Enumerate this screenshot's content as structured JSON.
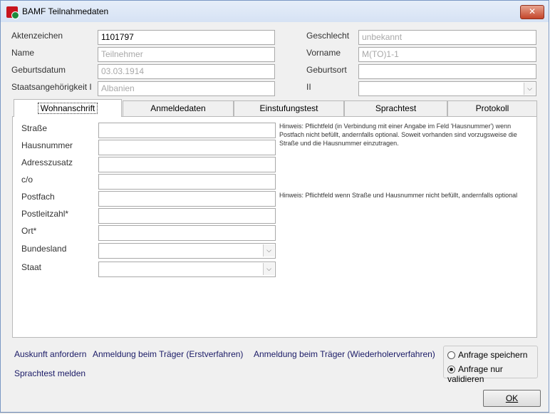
{
  "window": {
    "title": "BAMF Teilnahmedaten",
    "close_symbol": "✕"
  },
  "header_fields": {
    "aktenzeichen": {
      "label": "Aktenzeichen",
      "value": "1101797"
    },
    "name": {
      "label": "Name",
      "value": "Teilnehmer"
    },
    "geburtsdatum": {
      "label": "Geburtsdatum",
      "value": "03.03.1914"
    },
    "staatsangehoerigkeit": {
      "label": "Staatsangehörigkeit I",
      "value": "Albanien"
    },
    "geschlecht": {
      "label": "Geschlecht",
      "value": "unbekannt"
    },
    "vorname": {
      "label": "Vorname",
      "value": "M(TO)1-1"
    },
    "geburtsort": {
      "label": "Geburtsort",
      "value": ""
    },
    "staatsangehoerigkeit2": {
      "label": "II",
      "value": ""
    }
  },
  "tabs": [
    {
      "label": "Wohnanschrift",
      "active": true
    },
    {
      "label": "Anmeldedaten",
      "active": false
    },
    {
      "label": "Einstufungstest",
      "active": false
    },
    {
      "label": "Sprachtest",
      "active": false
    },
    {
      "label": "Protokoll",
      "active": false
    }
  ],
  "address_form": {
    "strasse": {
      "label": "Straße",
      "value": ""
    },
    "hausnummer": {
      "label": "Hausnummer",
      "value": ""
    },
    "adresszusatz": {
      "label": "Adresszusatz",
      "value": ""
    },
    "co": {
      "label": "c/o",
      "value": ""
    },
    "postfach": {
      "label": "Postfach",
      "value": ""
    },
    "postleitzahl": {
      "label": "Postleitzahl*",
      "value": ""
    },
    "ort": {
      "label": "Ort*",
      "value": ""
    },
    "bundesland": {
      "label": "Bundesland",
      "value": ""
    },
    "staat": {
      "label": "Staat",
      "value": ""
    }
  },
  "hints": {
    "strasse_line1": "Hinweis: Pflichtfeld (in Verbindung mit einer Angabe im Feld 'Hausnummer') wenn",
    "strasse_line2": "Postfach nicht befüllt, andernfalls optional. Soweit vorhanden sind vorzugsweise die",
    "strasse_line3": "Straße und die Hausnummer einzutragen.",
    "postfach": "Hinweis: Pflichtfeld wenn Straße und Hausnummer nicht befüllt, andernfalls optional"
  },
  "actions": {
    "auskunft": "Auskunft anfordern",
    "anmeldung_erst": "Anmeldung beim Träger (Erstverfahren)",
    "anmeldung_wiederholer": "Anmeldung beim Träger (Wiederholerverfahren)",
    "sprachtest": "Sprachtest melden"
  },
  "radio_options": [
    {
      "label": "Anfrage speichern",
      "selected": false
    },
    {
      "label": "Anfrage nur validieren",
      "selected": true
    }
  ],
  "ok_label": "OK",
  "combo_arrow": "⌵"
}
